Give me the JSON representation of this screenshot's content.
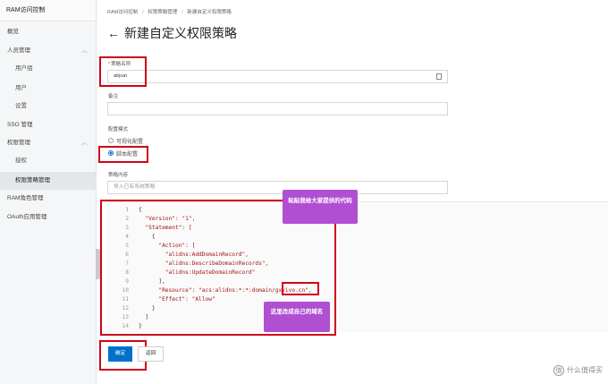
{
  "sidebar": {
    "brand": "RAM访问控制",
    "items": [
      {
        "label": "概览"
      },
      {
        "label": "人员管理"
      },
      {
        "label": "用户组"
      },
      {
        "label": "用户"
      },
      {
        "label": "设置"
      },
      {
        "label": "SSO 管理"
      },
      {
        "label": "权限管理"
      },
      {
        "label": "授权"
      },
      {
        "label": "权限策略管理"
      },
      {
        "label": "RAM角色管理"
      },
      {
        "label": "OAuth应用管理"
      }
    ]
  },
  "breadcrumb": [
    "RAM访问控制",
    "权限策略管理",
    "新建自定义权限策略"
  ],
  "page_title": "新建自定义权限策略",
  "form": {
    "name_label": "策略名称",
    "name_value": "aliyun",
    "remark_label": "备注",
    "remark_value": "",
    "mode_label": "配置模式",
    "mode_visual": "可视化配置",
    "mode_script": "脚本配置",
    "content_label": "策略内容",
    "import_placeholder": "导入已有系统策略"
  },
  "editor": {
    "lines": [
      "{",
      "  \"Version\": \"1\",",
      "  \"Statement\": [",
      "    {",
      "      \"Action\": [",
      "        \"alidns:AddDomainRecord\",",
      "        \"alidns:DescribeDomainRecords\",",
      "        \"alidns:UpdateDomainRecord\"",
      "      ],",
      "      \"Resource\": \"acs:alidns:*:*:domain/gxvivo.cn\",",
      "      \"Effect\": \"Allow\"",
      "    }",
      "  ]",
      "}"
    ]
  },
  "notes": {
    "paste": "粘贴我给大家提供的代码",
    "domain": "这里改成自己的域名"
  },
  "buttons": {
    "confirm": "确定",
    "back": "返回"
  },
  "watermark": "什么值得买"
}
